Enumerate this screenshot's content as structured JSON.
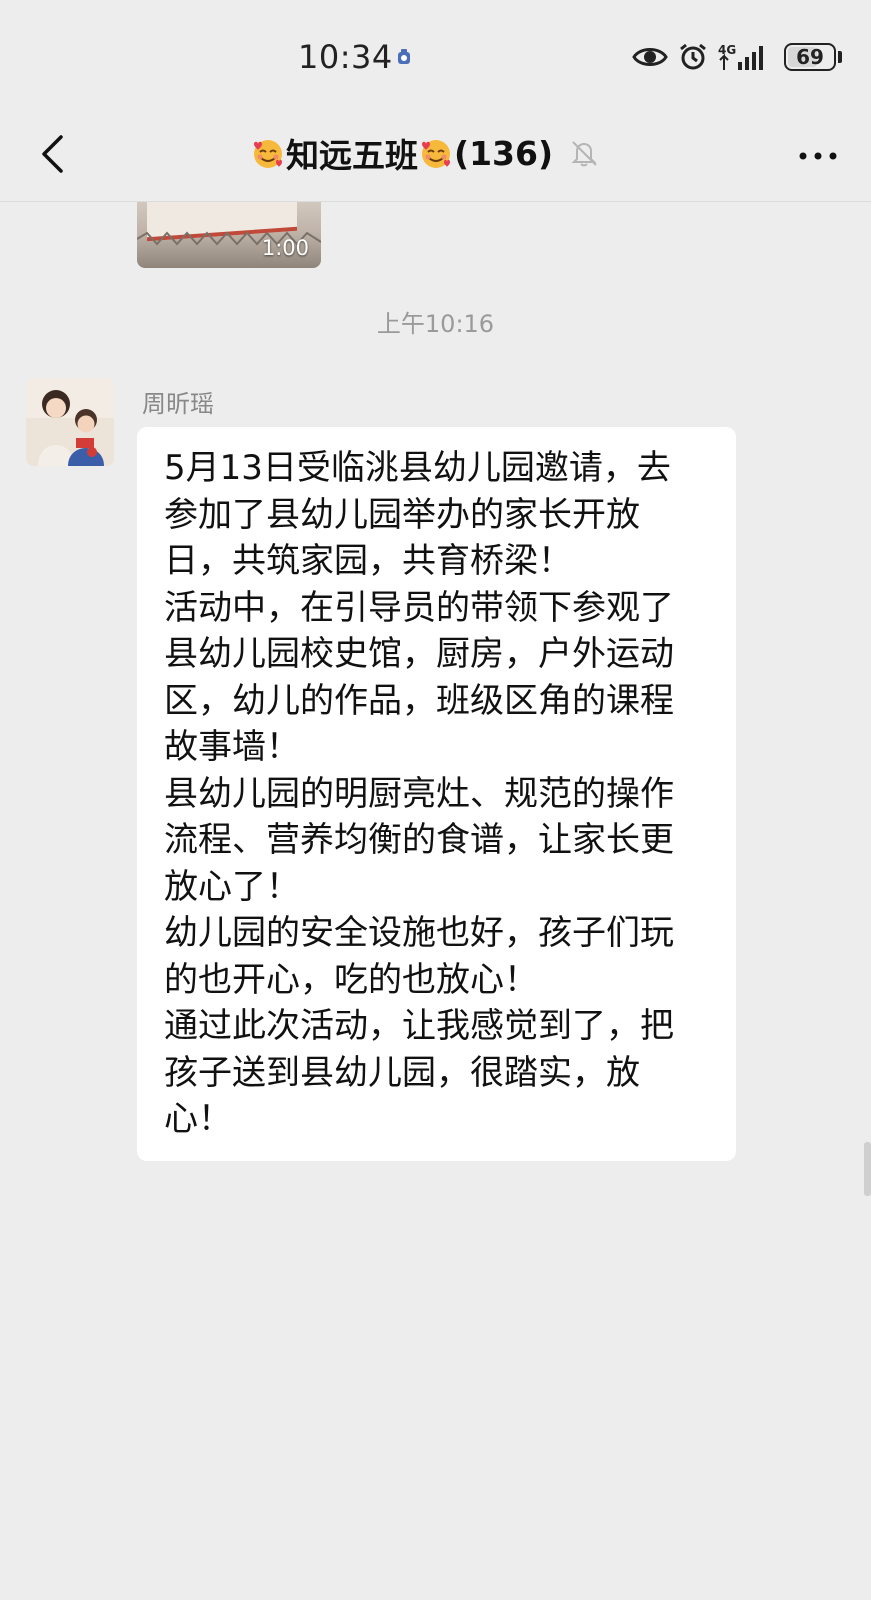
{
  "status_bar": {
    "time": "10:34",
    "network": "4G",
    "battery_level": 69,
    "battery_text": "69",
    "icons": [
      "alarm-dot-icon",
      "eye-icon",
      "alarm-icon",
      "signal-icon",
      "battery-icon"
    ]
  },
  "header": {
    "title": "知远五班",
    "member_count": "(136)",
    "emoji": "smiling-face-with-hearts",
    "muted": true
  },
  "messages": {
    "video": {
      "duration": "1:00"
    },
    "timestamp": "上午10:16",
    "text_message": {
      "sender": "周昕瑶",
      "lines": [
        "5月13日受临洮县幼儿园邀请，去",
        "参加了县幼儿园举办的家长开放",
        "日，共筑家园，共育桥梁！",
        "活动中，在引导员的带领下参观了",
        "县幼儿园校史馆，厨房，户外运动",
        "区，幼儿的作品，班级区角的课程",
        "故事墙！",
        "县幼儿园的明厨亮灶、规范的操作",
        "流程、营养均衡的食谱，让家长更",
        "放心了！",
        "幼儿园的安全设施也好，孩子们玩",
        "的也开心，吃的也放心！",
        "通过此次活动，让我感觉到了，把",
        "孩子送到县幼儿园，很踏实，放",
        "心！"
      ]
    }
  },
  "colors": {
    "background": "#ededed",
    "bubble": "#ffffff",
    "text": "#111111",
    "meta_text": "#9a9a9a"
  }
}
